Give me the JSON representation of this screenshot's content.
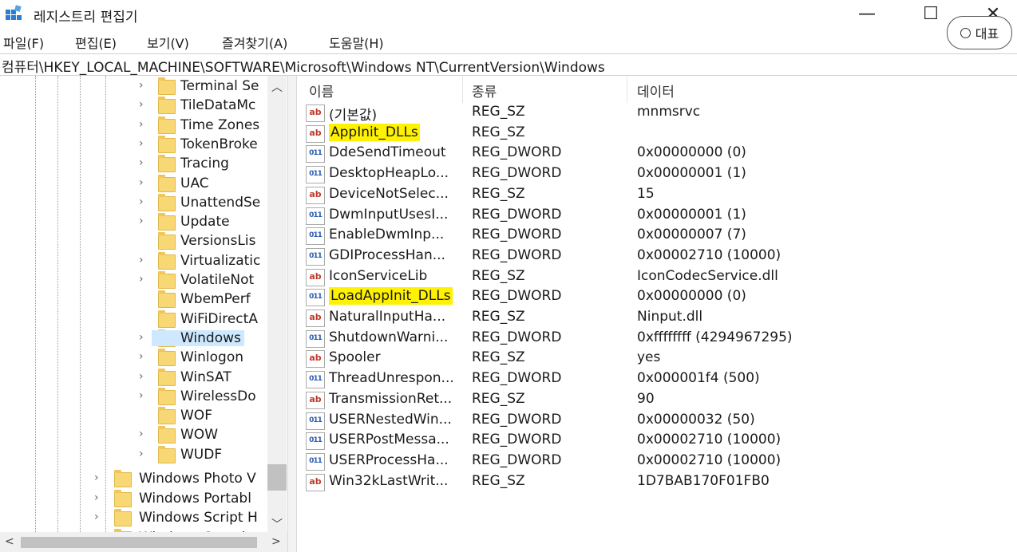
{
  "window": {
    "title": "레지스트리 편집기",
    "min_glyph": "—",
    "max_glyph": "☐",
    "close_glyph": "✕"
  },
  "popup": {
    "label": "대표"
  },
  "menu": [
    "파일(F)",
    "편집(E)",
    "보기(V)",
    "즐겨찾기(A)",
    "도움말(H)"
  ],
  "address": "컴퓨터\\HKEY_LOCAL_MACHINE\\SOFTWARE\\Microsoft\\Windows NT\\CurrentVersion\\Windows",
  "tree": {
    "items": [
      {
        "label": "Terminal Se",
        "expandable": true
      },
      {
        "label": "TileDataMc",
        "expandable": true
      },
      {
        "label": "Time Zones",
        "expandable": true
      },
      {
        "label": "TokenBroke",
        "expandable": true
      },
      {
        "label": "Tracing",
        "expandable": true
      },
      {
        "label": "UAC",
        "expandable": true
      },
      {
        "label": "UnattendSe",
        "expandable": true
      },
      {
        "label": "Update",
        "expandable": true
      },
      {
        "label": "VersionsLis",
        "expandable": false
      },
      {
        "label": "Virtualizatic",
        "expandable": true
      },
      {
        "label": "VolatileNot",
        "expandable": true
      },
      {
        "label": "WbemPerf",
        "expandable": false
      },
      {
        "label": "WiFiDirectA",
        "expandable": false
      },
      {
        "label": "Windows",
        "expandable": true,
        "selected": true
      },
      {
        "label": "Winlogon",
        "expandable": true
      },
      {
        "label": "WinSAT",
        "expandable": true
      },
      {
        "label": "WirelessDo",
        "expandable": true
      },
      {
        "label": "WOF",
        "expandable": false
      },
      {
        "label": "WOW",
        "expandable": true
      },
      {
        "label": "WUDF",
        "expandable": true
      }
    ],
    "parent_items": [
      {
        "label": "Windows Photo V"
      },
      {
        "label": "Windows Portabl"
      },
      {
        "label": "Windows Script H"
      },
      {
        "label": "Windows Search"
      }
    ]
  },
  "list": {
    "columns": [
      "이름",
      "종류",
      "데이터"
    ],
    "rows": [
      {
        "name": "(기본값)",
        "type": "REG_SZ",
        "data": "mnmsrvc",
        "icon": "string-value-icon"
      },
      {
        "name": "AppInit_DLLs",
        "type": "REG_SZ",
        "data": "",
        "icon": "string-value-icon",
        "highlighted": true
      },
      {
        "name": "DdeSendTimeout",
        "type": "REG_DWORD",
        "data": "0x00000000 (0)",
        "icon": "dword-value-icon"
      },
      {
        "name": "DesktopHeapLo...",
        "type": "REG_DWORD",
        "data": "0x00000001 (1)",
        "icon": "dword-value-icon"
      },
      {
        "name": "DeviceNotSelec...",
        "type": "REG_SZ",
        "data": "15",
        "icon": "string-value-icon"
      },
      {
        "name": "DwmInputUsesI...",
        "type": "REG_DWORD",
        "data": "0x00000001 (1)",
        "icon": "dword-value-icon"
      },
      {
        "name": "EnableDwmInp...",
        "type": "REG_DWORD",
        "data": "0x00000007 (7)",
        "icon": "dword-value-icon"
      },
      {
        "name": "GDIProcessHan...",
        "type": "REG_DWORD",
        "data": "0x00002710 (10000)",
        "icon": "dword-value-icon"
      },
      {
        "name": "IconServiceLib",
        "type": "REG_SZ",
        "data": "IconCodecService.dll",
        "icon": "string-value-icon"
      },
      {
        "name": "LoadAppInit_DLLs",
        "type": "REG_DWORD",
        "data": "0x00000000 (0)",
        "icon": "dword-value-icon",
        "highlighted": true
      },
      {
        "name": "NaturalInputHa...",
        "type": "REG_SZ",
        "data": "Ninput.dll",
        "icon": "string-value-icon"
      },
      {
        "name": "ShutdownWarni...",
        "type": "REG_DWORD",
        "data": "0xffffffff (4294967295)",
        "icon": "dword-value-icon"
      },
      {
        "name": "Spooler",
        "type": "REG_SZ",
        "data": "yes",
        "icon": "string-value-icon"
      },
      {
        "name": "ThreadUnrespon...",
        "type": "REG_DWORD",
        "data": "0x000001f4 (500)",
        "icon": "dword-value-icon"
      },
      {
        "name": "TransmissionRet...",
        "type": "REG_SZ",
        "data": "90",
        "icon": "string-value-icon"
      },
      {
        "name": "USERNestedWin...",
        "type": "REG_DWORD",
        "data": "0x00000032 (50)",
        "icon": "dword-value-icon"
      },
      {
        "name": "USERPostMessa...",
        "type": "REG_DWORD",
        "data": "0x00002710 (10000)",
        "icon": "dword-value-icon"
      },
      {
        "name": "USERProcessHa...",
        "type": "REG_DWORD",
        "data": "0x00002710 (10000)",
        "icon": "dword-value-icon"
      },
      {
        "name": "Win32kLastWrit...",
        "type": "REG_SZ",
        "data": "1D7BAB170F01FB0",
        "icon": "string-value-icon"
      }
    ]
  },
  "colors": {
    "highlight": "#fff200",
    "selection": "#cde8ff",
    "folder": "#f8d775"
  }
}
